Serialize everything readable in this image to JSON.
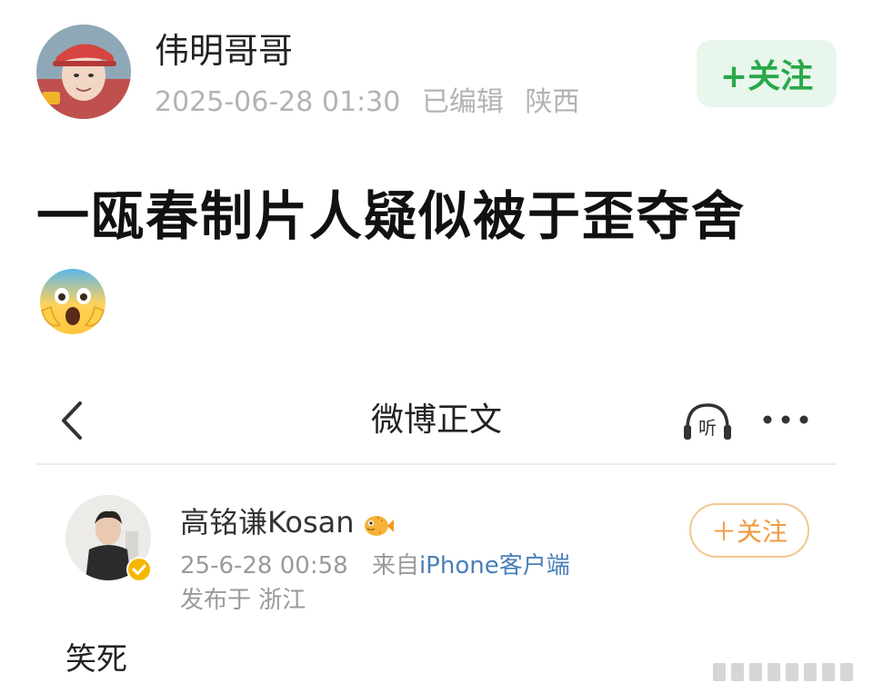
{
  "post": {
    "author_name": "伟明哥哥",
    "timestamp": "2025-06-28 01:30",
    "edited_label": "已编辑",
    "location": "陕西",
    "follow_label": "+关注",
    "headline": "一瓯春制片人疑似被于歪夺舍",
    "emoji": "fearful-screaming-face-emoji"
  },
  "embedded": {
    "nav": {
      "back_icon": "chevron-left-icon",
      "title": "微博正文",
      "listen_icon": "headphones-listen-icon",
      "listen_label": "听",
      "more_icon": "ellipsis-icon"
    },
    "author": {
      "name": "高铭谦Kosan",
      "badge_icon": "pufferfish-icon",
      "verified_icon": "verified-badge-icon",
      "time": "25-6-28 00:58",
      "source_prefix": "来自",
      "source_client": "iPhone客户端",
      "location_line": "发布于 浙江",
      "follow_label": "＋关注"
    },
    "body_text": "笑死"
  },
  "colors": {
    "follow_main_bg": "#e8f6ec",
    "follow_main_text": "#2aa84a",
    "follow_sub_border": "#f2c791",
    "follow_sub_text": "#f19a3e",
    "link_blue": "#4a7fb8",
    "meta_gray": "#b3b3b3",
    "verified_gold": "#f5b800"
  }
}
